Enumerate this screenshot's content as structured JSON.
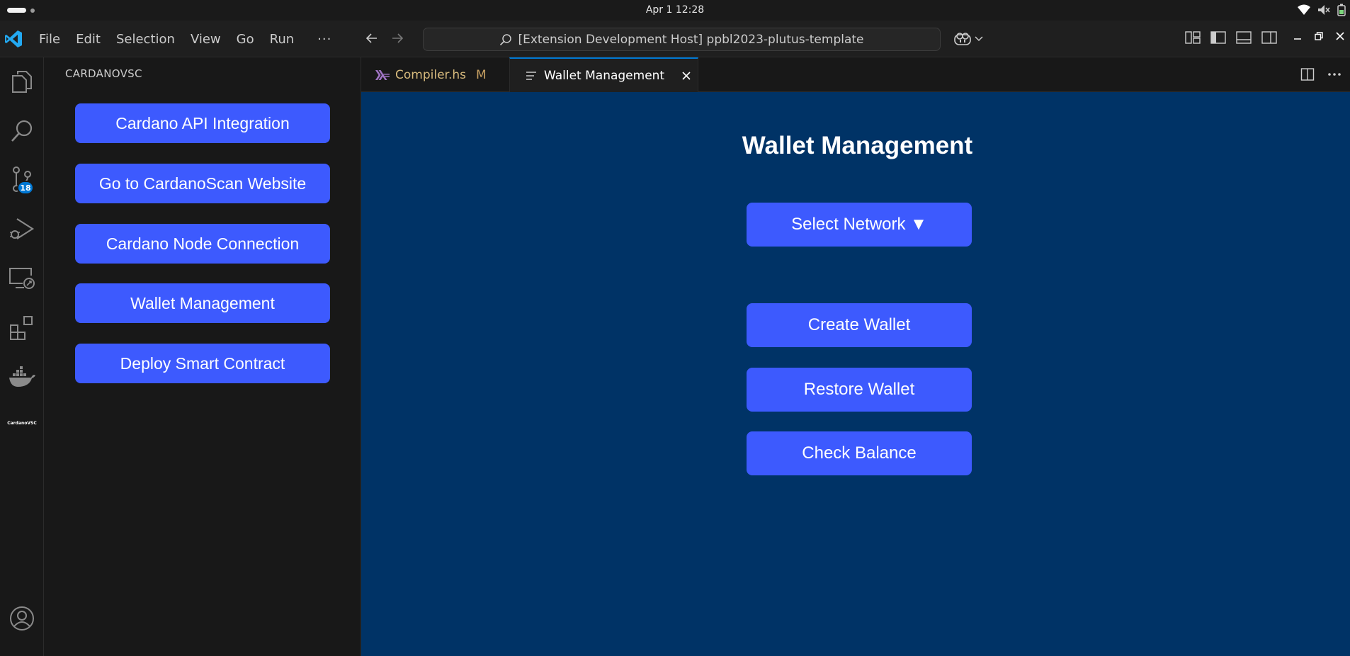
{
  "os": {
    "clock": "Apr 1  12:28"
  },
  "titlebar": {
    "menu": [
      "File",
      "Edit",
      "Selection",
      "View",
      "Go",
      "Run"
    ],
    "more": "···",
    "command_center": "[Extension Development Host] ppbl2023-plutus-template"
  },
  "activity_bar": {
    "source_control_badge": "18",
    "cardano_label": "CardanoVSC"
  },
  "sidebar": {
    "title": "CARDANOVSC",
    "buttons": [
      "Cardano API Integration",
      "Go to CardanoScan Website",
      "Cardano Node Connection",
      "Wallet Management",
      "Deploy Smart Contract"
    ]
  },
  "tabs": [
    {
      "label": "Compiler.hs",
      "status": "M"
    },
    {
      "label": "Wallet Management"
    }
  ],
  "webview": {
    "title": "Wallet Management",
    "select_network": "Select Network ▼",
    "create_wallet": "Create Wallet",
    "restore_wallet": "Restore Wallet",
    "check_balance": "Check Balance"
  },
  "colors": {
    "accent_button": "#3d5afe",
    "webview_background": "#003366",
    "tab_active_border": "#0078d4",
    "badge": "#0078d4"
  }
}
